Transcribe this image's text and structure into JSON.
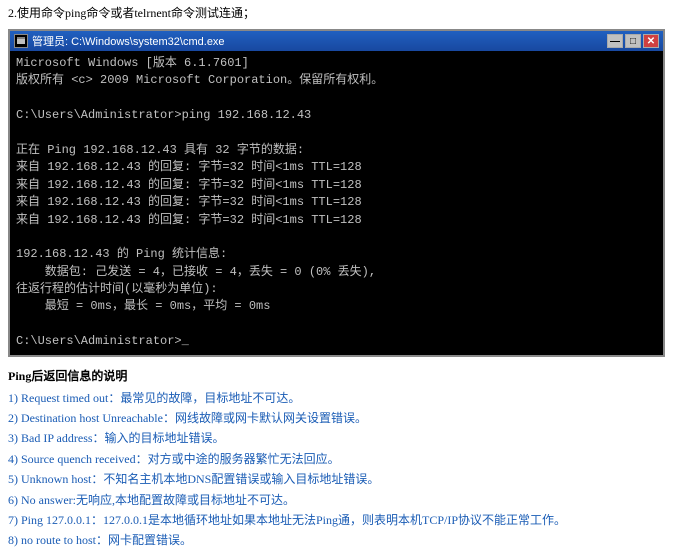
{
  "instruction": "2.使用命令ping命令或者telrnent命令测试连通；",
  "cmd": {
    "title": "管理员: C:\\Windows\\system32\\cmd.exe",
    "lines": [
      "Microsoft Windows [版本 6.1.7601]",
      "版权所有 <c> 2009 Microsoft Corporation。保留所有权利。",
      "",
      "C:\\Users\\Administrator>ping 192.168.12.43",
      "",
      "正在 Ping 192.168.12.43 具有 32 字节的数据:",
      "来自 192.168.12.43 的回复: 字节=32 时间<1ms TTL=128",
      "来自 192.168.12.43 的回复: 字节=32 时间<1ms TTL=128",
      "来自 192.168.12.43 的回复: 字节=32 时间<1ms TTL=128",
      "来自 192.168.12.43 的回复: 字节=32 时间<1ms TTL=128",
      "",
      "192.168.12.43 的 Ping 统计信息:",
      "    数据包: 己发送 = 4，已接收 = 4，丢失 = 0 (0% 丢失),",
      "往返行程的估计时间(以毫秒为单位):",
      "    最短 = 0ms，最长 = 0ms，平均 = 0ms",
      "",
      "C:\\Users\\Administrator>_"
    ],
    "buttons": {
      "minimize": "—",
      "maximize": "□",
      "close": "✕"
    }
  },
  "ping_section_title": "Ping后返回信息的说明",
  "ping_items": [
    {
      "num": "1)",
      "text": "Request timed out：最常见的故障，目标地址不可达。"
    },
    {
      "num": "2)",
      "text": "Destination host Unreachable：网线故障或网卡默认网关设置错误。"
    },
    {
      "num": "3)",
      "text": "Bad IP address：输入的目标地址错误。"
    },
    {
      "num": "4)",
      "text": "Source quench received：对方或中途的服务器繁忙无法回应。"
    },
    {
      "num": "5)",
      "text": "Unknown host：不知名主机本地DNS配置错误或输入目标地址错误。"
    },
    {
      "num": "6)",
      "text": "No answer:无响应,本地配置故障或目标地址不可达。"
    },
    {
      "num": "7)",
      "text": "Ping 127.0.0.1：127.0.0.1是本地循环地址如果本地址无法Ping通，则表明本机TCP/IP协议不能正常工作。"
    },
    {
      "num": "8)",
      "text": "no route to host：网卡配置错误。"
    }
  ]
}
